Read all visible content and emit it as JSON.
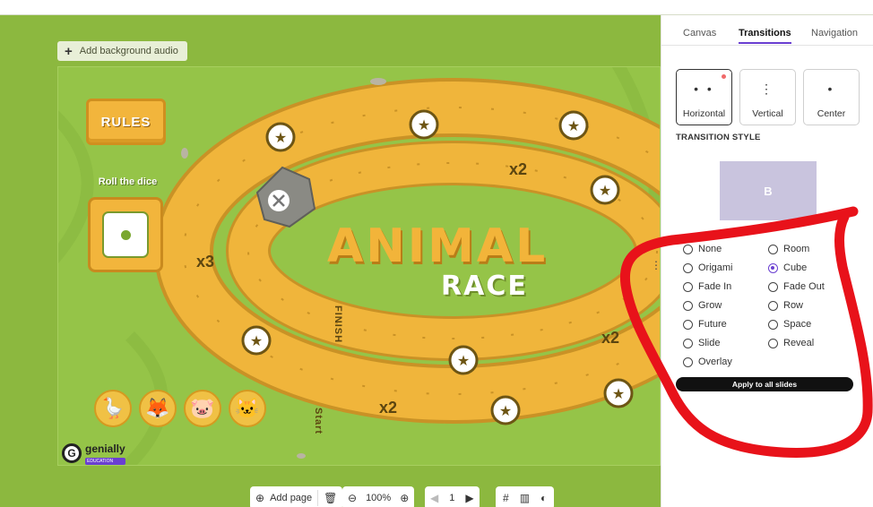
{
  "workspace": {
    "add_audio_label": "Add background audio"
  },
  "slide": {
    "rules_label": "RULES",
    "roll_label": "Roll the dice",
    "title_main": "ANIMAL",
    "title_sub": "RACE",
    "finish_label": "FINISH",
    "start_label": "Start",
    "multipliers": [
      "x2",
      "x3",
      "x2",
      "x2"
    ],
    "avatars": [
      "goose-avatar",
      "fox-avatar",
      "pig-avatar",
      "cat-avatar"
    ],
    "logo_text": "genially",
    "logo_sub": "EDUCATION"
  },
  "toolbar": {
    "add_page_label": "Add page",
    "zoom_value": "100%",
    "page_number": "1"
  },
  "panel": {
    "tabs": [
      "Canvas",
      "Transitions",
      "Navigation"
    ],
    "active_tab": "Transitions",
    "directions": [
      {
        "label": "Horizontal",
        "icon": "• •"
      },
      {
        "label": "Vertical",
        "icon": "⋮"
      },
      {
        "label": "Center",
        "icon": "•"
      }
    ],
    "section_title": "TRANSITION STYLE",
    "preview_letter": "B",
    "options_left": [
      "None",
      "Origami",
      "Fade In",
      "Grow",
      "Future",
      "Slide",
      "Overlay"
    ],
    "options_right": [
      "Room",
      "Cube",
      "Fade Out",
      "Row",
      "Space",
      "Reveal"
    ],
    "selected_option": "Cube",
    "apply_label": "Apply to all slides"
  },
  "colors": {
    "accent": "#6a3fd1",
    "annotation": "#e8121a",
    "board_green": "#95c448",
    "tile_yellow": "#f2b53c"
  }
}
